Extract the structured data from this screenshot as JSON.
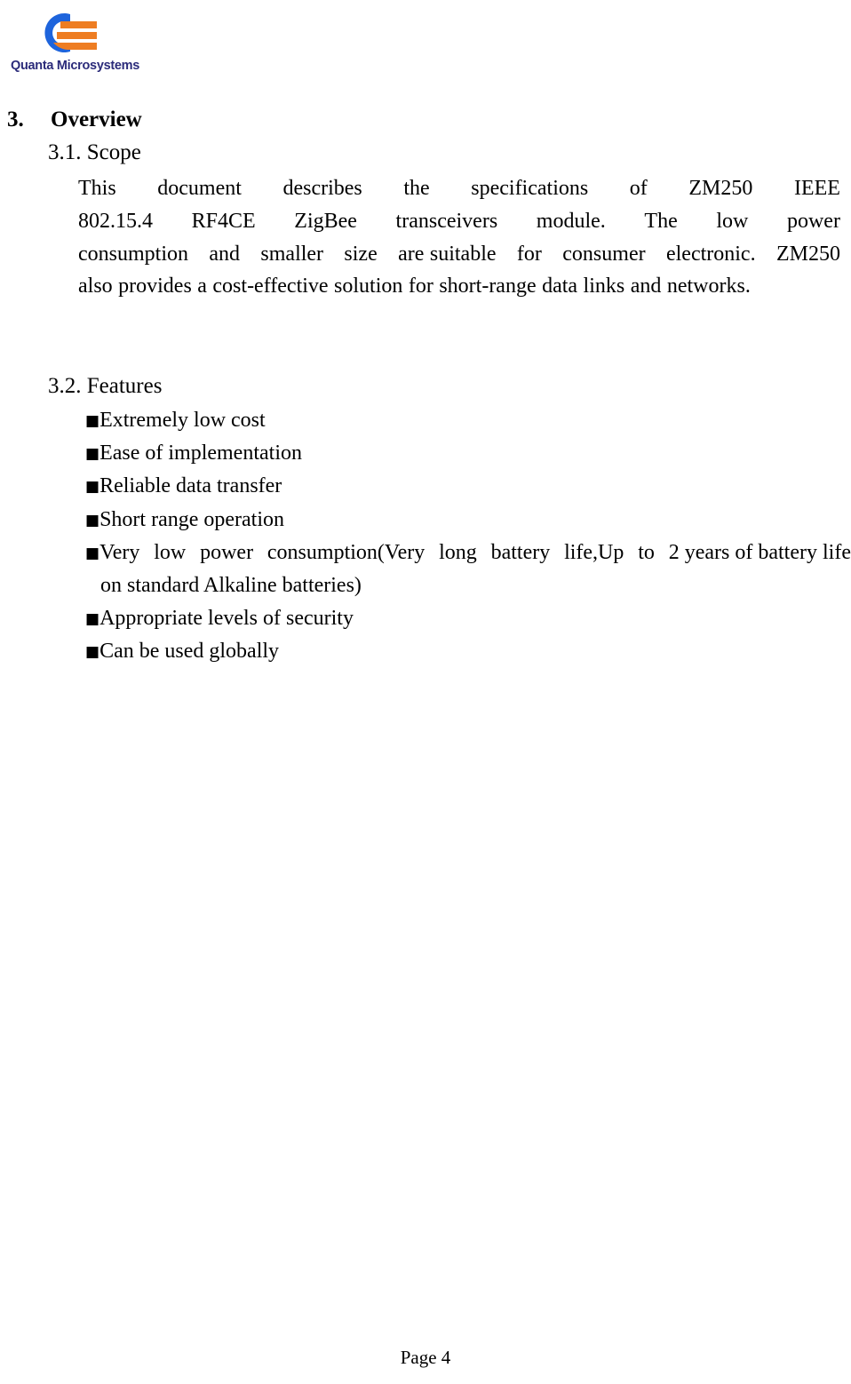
{
  "logo": {
    "company_name": "Quanta Microsystems",
    "mark_icon": "quanta-c-arc-logo-icon",
    "arc_color": "#1e64dc",
    "bar_color": "#ee7d22",
    "wordmark_color": "#2b2b7a"
  },
  "section": {
    "number": "3.",
    "title": "Overview"
  },
  "scope": {
    "heading": "3.1. Scope",
    "lines": [
      [
        "This",
        "document",
        "describes",
        "the",
        "specifications",
        "of",
        "ZM250",
        "IEEE"
      ],
      [
        "802.15.4",
        "RF4CE",
        "ZigBee",
        "transceivers",
        "module.",
        "The",
        "low",
        "power"
      ],
      [
        "consumption",
        "and",
        "smaller",
        "size",
        "are suitable",
        "for",
        "consumer",
        "electronic.",
        "ZM250"
      ],
      [
        "also provides a cost-effective solution for short-range data links and networks."
      ]
    ],
    "full_text": "This document describes the specifications of ZM250 IEEE 802.15.4 RF4CE ZigBee transceivers module. The low power consumption and smaller size are suitable for consumer electronic. ZM250 also provides a cost-effective solution for short-range data links and networks."
  },
  "features": {
    "heading": "3.2. Features",
    "bullet_glyph": "■",
    "items": [
      {
        "text": "Extremely low cost",
        "type": "simple"
      },
      {
        "text": "Ease of implementation",
        "type": "simple"
      },
      {
        "text": "Reliable data transfer",
        "type": "simple"
      },
      {
        "text": "Short range operation",
        "type": "simple"
      },
      {
        "type": "wrapped",
        "line1_words": [
          "Very",
          "low",
          "power",
          "consumption(Very",
          "long",
          "battery",
          "life,Up",
          "to",
          "2 years of battery life"
        ],
        "line2": "on standard Alkaline batteries)",
        "text": "Very low power consumption(Very long battery life,Up  to  2 years of battery life on standard Alkaline batteries)"
      },
      {
        "text": "Appropriate  levels  of  security",
        "type": "simple"
      },
      {
        "text": "Can be used globally",
        "type": "simple"
      }
    ]
  },
  "footer": {
    "page_label": "Page 4"
  }
}
